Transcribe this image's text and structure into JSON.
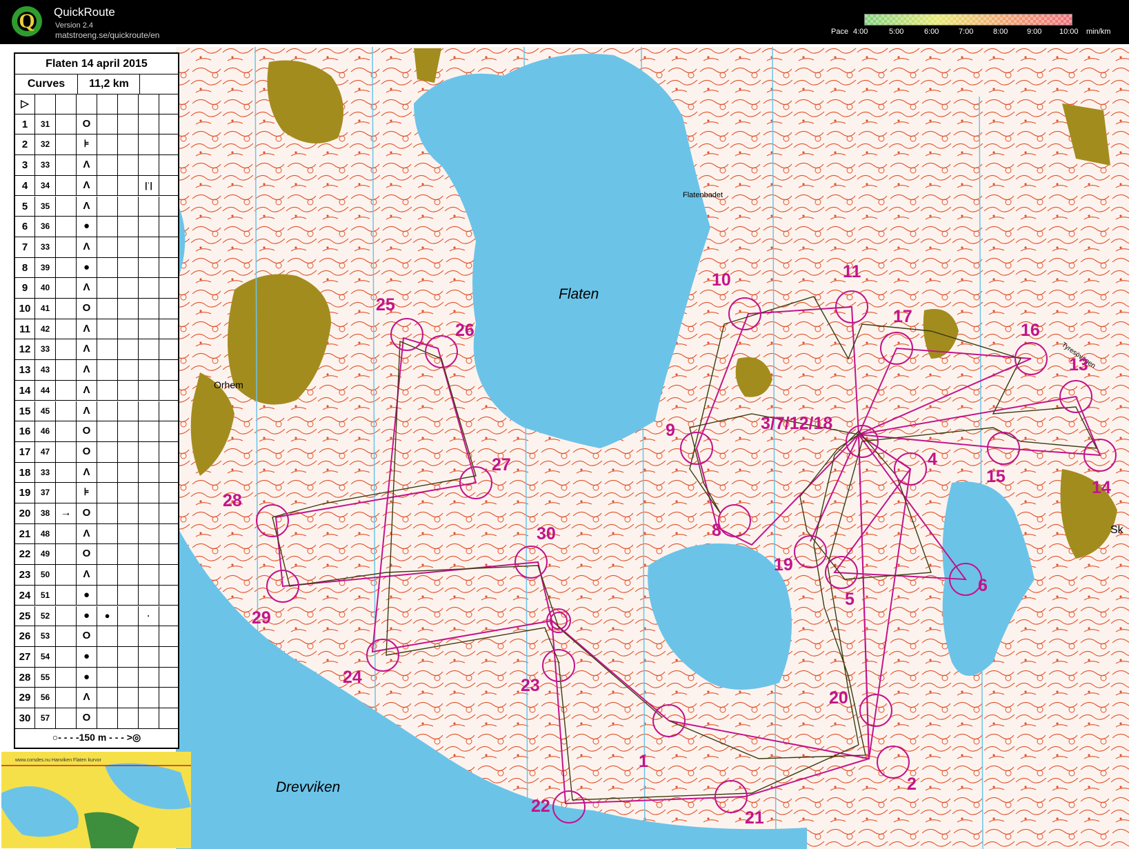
{
  "app": {
    "name": "QuickRoute",
    "version": "Version 2.4",
    "url": "matstroeng.se/quickroute/en"
  },
  "pace": {
    "label": "Pace",
    "ticks": [
      "4:00",
      "5:00",
      "6:00",
      "7:00",
      "8:00",
      "9:00",
      "10:00"
    ],
    "unit": "min/km"
  },
  "legend": {
    "title": "Flaten 14 april 2015",
    "class": "Curves",
    "distance": "11,2 km",
    "start_symbol": "▷",
    "controls": [
      {
        "n": "1",
        "code": "31",
        "sym": "O",
        "extra": ""
      },
      {
        "n": "2",
        "code": "32",
        "sym": "⊧",
        "extra": ""
      },
      {
        "n": "3",
        "code": "33",
        "sym": "Λ",
        "extra": ""
      },
      {
        "n": "4",
        "code": "34",
        "sym": "Λ",
        "extra": "|ˈ|"
      },
      {
        "n": "5",
        "code": "35",
        "sym": "Λ",
        "extra": ""
      },
      {
        "n": "6",
        "code": "36",
        "sym": "●",
        "extra": ""
      },
      {
        "n": "7",
        "code": "33",
        "sym": "Λ",
        "extra": ""
      },
      {
        "n": "8",
        "code": "39",
        "sym": "●",
        "extra": ""
      },
      {
        "n": "9",
        "code": "40",
        "sym": "Λ",
        "extra": ""
      },
      {
        "n": "10",
        "code": "41",
        "sym": "O",
        "extra": ""
      },
      {
        "n": "11",
        "code": "42",
        "sym": "Λ",
        "extra": ""
      },
      {
        "n": "12",
        "code": "33",
        "sym": "Λ",
        "extra": ""
      },
      {
        "n": "13",
        "code": "43",
        "sym": "Λ",
        "extra": ""
      },
      {
        "n": "14",
        "code": "44",
        "sym": "Λ",
        "extra": ""
      },
      {
        "n": "15",
        "code": "45",
        "sym": "Λ",
        "extra": ""
      },
      {
        "n": "16",
        "code": "46",
        "sym": "O",
        "extra": ""
      },
      {
        "n": "17",
        "code": "47",
        "sym": "O",
        "extra": ""
      },
      {
        "n": "18",
        "code": "33",
        "sym": "Λ",
        "extra": ""
      },
      {
        "n": "19",
        "code": "37",
        "sym": "⊧",
        "extra": ""
      },
      {
        "n": "20",
        "code": "38",
        "sym": "O",
        "extra": "",
        "pre": "→"
      },
      {
        "n": "21",
        "code": "48",
        "sym": "Λ",
        "extra": ""
      },
      {
        "n": "22",
        "code": "49",
        "sym": "O",
        "extra": ""
      },
      {
        "n": "23",
        "code": "50",
        "sym": "Λ",
        "extra": ""
      },
      {
        "n": "24",
        "code": "51",
        "sym": "●",
        "extra": ""
      },
      {
        "n": "25",
        "code": "52",
        "sym": "●",
        "sym2": "●",
        "extra": "·"
      },
      {
        "n": "26",
        "code": "53",
        "sym": "O",
        "extra": ""
      },
      {
        "n": "27",
        "code": "54",
        "sym": "●",
        "extra": ""
      },
      {
        "n": "28",
        "code": "55",
        "sym": "●",
        "extra": ""
      },
      {
        "n": "29",
        "code": "56",
        "sym": "Λ",
        "extra": ""
      },
      {
        "n": "30",
        "code": "57",
        "sym": "O",
        "extra": ""
      }
    ],
    "finish": "○- - - -150 m - - - >◎"
  },
  "map_labels": {
    "lake": "Flaten",
    "bay": "Drevviken",
    "village": "Orhem",
    "beach": "Flatenbadet",
    "road": "Tyresövägen",
    "edge": "Sk",
    "credit": "www.corsdes.nu Hanviken\nFlaten kurvor"
  },
  "colors": {
    "course": "#c2148a",
    "contour": "#e0522a",
    "water": "#6cc3e8",
    "vegetation": "#a38c1e",
    "route": "#3a3a10"
  },
  "controls_on_map": [
    "1",
    "2",
    "4",
    "5",
    "6",
    "8",
    "9",
    "10",
    "11",
    "13",
    "14",
    "15",
    "16",
    "17",
    "19",
    "20",
    "21",
    "22",
    "23",
    "24",
    "25",
    "26",
    "27",
    "28",
    "29",
    "30",
    "3/7/12/18"
  ]
}
